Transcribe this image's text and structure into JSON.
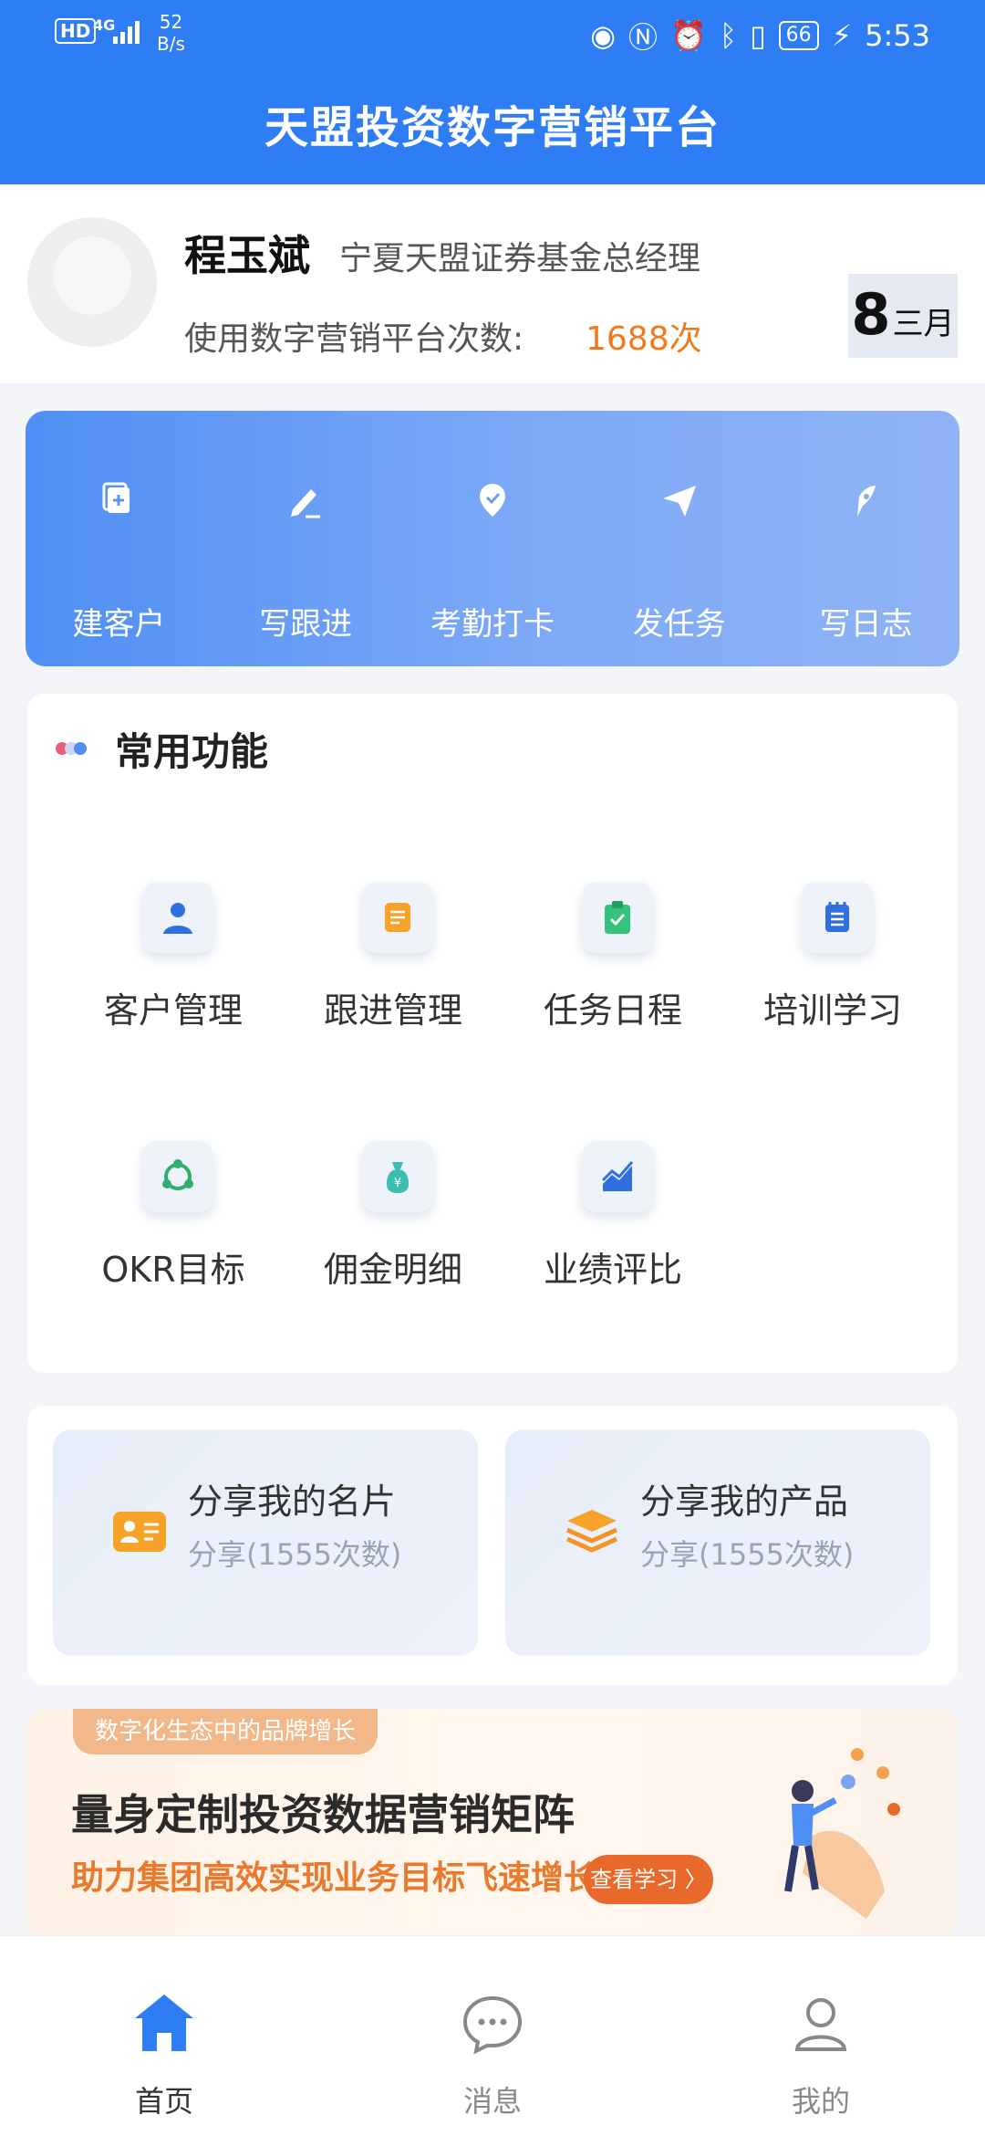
{
  "status_bar": {
    "hd": "HD",
    "network": "4G",
    "speed_value": "52",
    "speed_unit": "B/s",
    "battery": "66",
    "time": "5:53"
  },
  "app_title": "天盟投资数字营销平台",
  "profile": {
    "name": "程玉斌",
    "position": "宁夏天盟证券基金总经理",
    "usage_label": "使用数字营销平台次数:",
    "usage_count": "1688次",
    "date_day": "8",
    "date_month": "三月"
  },
  "quick_actions": [
    {
      "label": "建客户",
      "icon": "add-document-icon"
    },
    {
      "label": "写跟进",
      "icon": "pen-icon"
    },
    {
      "label": "考勤打卡",
      "icon": "location-pin-icon"
    },
    {
      "label": "发任务",
      "icon": "send-icon"
    },
    {
      "label": "写日志",
      "icon": "feather-pen-icon"
    }
  ],
  "common_section": {
    "title": "常用功能",
    "items": [
      {
        "label": "客户管理",
        "icon": "user-icon"
      },
      {
        "label": "跟进管理",
        "icon": "note-icon"
      },
      {
        "label": "任务日程",
        "icon": "clipboard-check-icon"
      },
      {
        "label": "培训学习",
        "icon": "notebook-icon"
      },
      {
        "label": "OKR目标",
        "icon": "cycle-icon"
      },
      {
        "label": "佣金明细",
        "icon": "money-bag-icon"
      },
      {
        "label": "业绩评比",
        "icon": "trend-chart-icon"
      }
    ]
  },
  "share": {
    "card1_title": "分享我的名片",
    "card1_sub": "分享(1555次数)",
    "card2_title": "分享我的产品",
    "card2_sub": "分享(1555次数)"
  },
  "banner": {
    "tag": "数字化生态中的品牌增长",
    "headline": "量身定制投资数据营销矩阵",
    "subline": "助力集团高效实现业务目标飞速增长",
    "button": "查看学习 〉"
  },
  "nav": [
    {
      "label": "首页",
      "icon": "home-icon",
      "active": true
    },
    {
      "label": "消息",
      "icon": "message-icon",
      "active": false
    },
    {
      "label": "我的",
      "icon": "person-icon",
      "active": false
    }
  ],
  "colors": {
    "primary": "#2f7df4",
    "accent_orange": "#f07a1c",
    "quick_gradient_start": "#4f8ff5",
    "quick_gradient_end": "#8fb3f5"
  }
}
